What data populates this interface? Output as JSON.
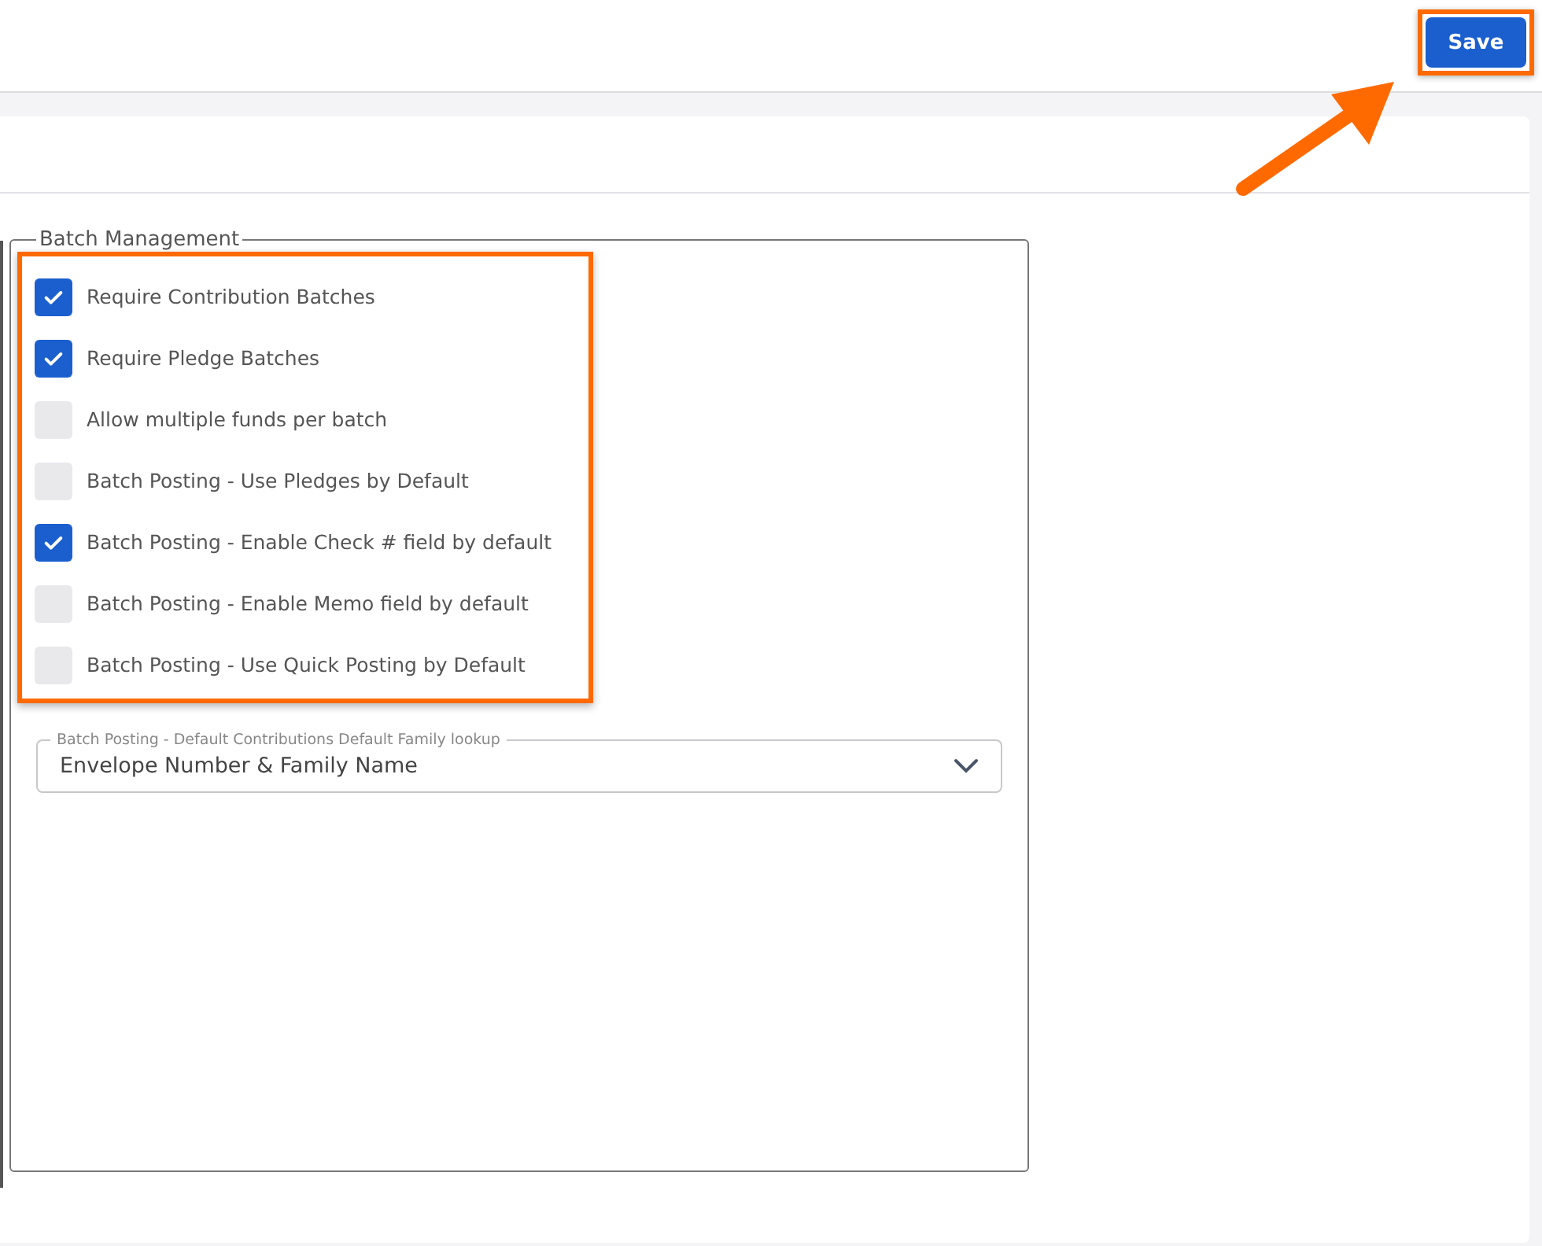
{
  "header": {
    "save_button": "Save"
  },
  "fieldset": {
    "legend": "Batch Management",
    "options": [
      {
        "label": "Require Contribution Batches",
        "checked": true
      },
      {
        "label": "Require Pledge Batches",
        "checked": true
      },
      {
        "label": "Allow multiple funds per batch",
        "checked": false
      },
      {
        "label": "Batch Posting - Use Pledges by Default",
        "checked": false
      },
      {
        "label": "Batch Posting - Enable Check # field by default",
        "checked": true
      },
      {
        "label": "Batch Posting - Enable Memo field by default",
        "checked": false
      },
      {
        "label": "Batch Posting - Use Quick Posting by Default",
        "checked": false
      }
    ],
    "lookup": {
      "label": "Batch Posting - Default Contributions Default Family lookup",
      "value": "Envelope Number & Family Name"
    }
  }
}
